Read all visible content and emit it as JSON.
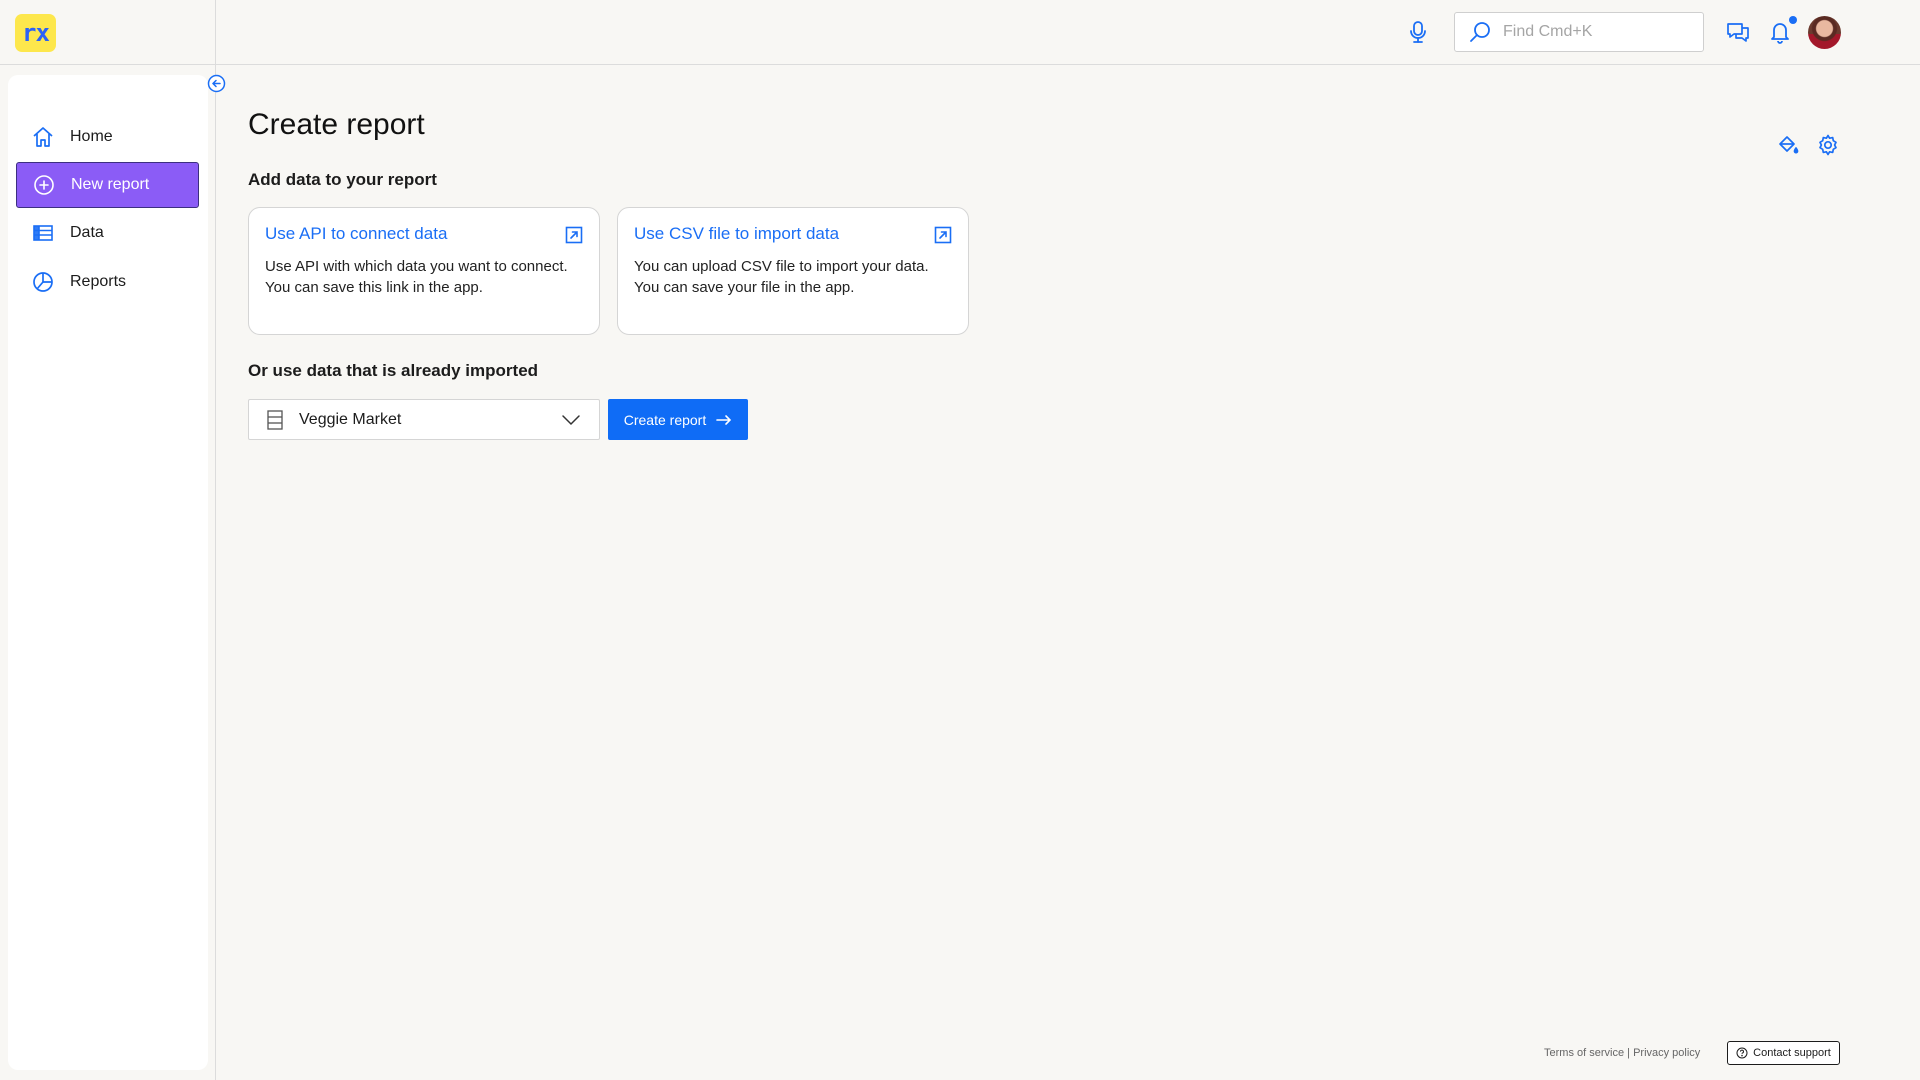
{
  "app": {
    "logo_text": "rx",
    "accent": "#1a6ef5",
    "brand_yellow": "#fde74c",
    "active_nav": "#8b5cf6"
  },
  "header": {
    "search": {
      "placeholder": "Find Cmd+K",
      "value": ""
    },
    "icons": [
      "microphone-icon",
      "search-icon",
      "chat-icon",
      "bell-icon",
      "avatar"
    ],
    "has_notification": true
  },
  "sidebar": {
    "items": [
      {
        "label": "Home",
        "icon": "home-icon",
        "active": false
      },
      {
        "label": "New report",
        "icon": "plus-circle-icon",
        "active": true
      },
      {
        "label": "Data",
        "icon": "table-icon",
        "active": false
      },
      {
        "label": "Reports",
        "icon": "pie-chart-icon",
        "active": false
      }
    ]
  },
  "main": {
    "title": "Create report",
    "add_data_heading": "Add data to your report",
    "cards": [
      {
        "title": "Use API to connect data",
        "description": "Use API with which data you want to connect.\nYou can save this link in the app."
      },
      {
        "title": "Use CSV file to import data",
        "description": "You can upload CSV file to import your data.\nYou can save your file in the app."
      }
    ],
    "existing_heading": "Or use data that is already imported",
    "dataset_select": {
      "value": "Veggie Market"
    },
    "create_button": "Create report"
  },
  "footer": {
    "terms": "Terms of service",
    "separator": "|",
    "privacy": "Privacy policy",
    "support": "Contact support"
  }
}
